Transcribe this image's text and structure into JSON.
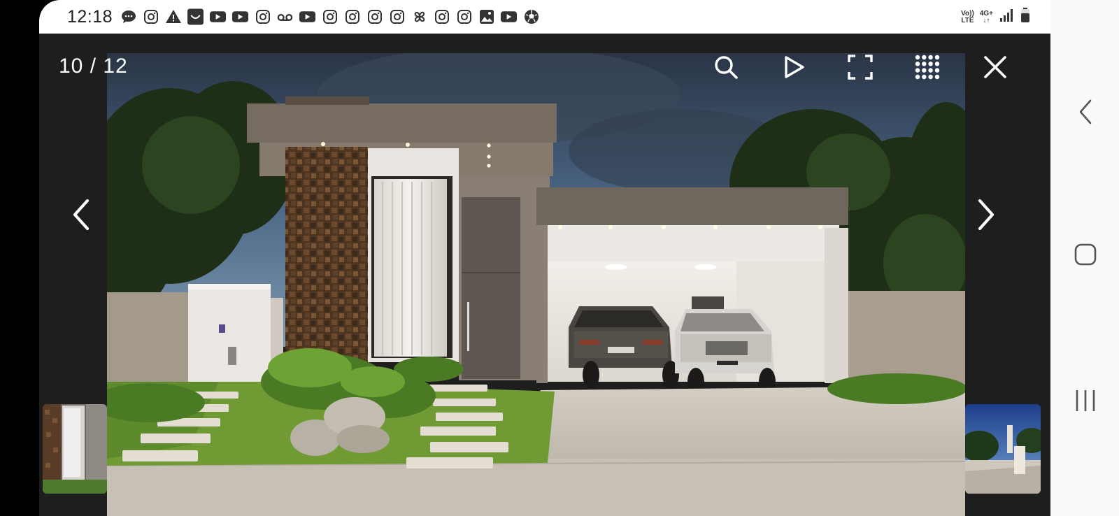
{
  "status_bar": {
    "time": "12:18",
    "notification_icons": [
      "chat-icon",
      "instagram-icon",
      "warning-icon",
      "smile-app-icon",
      "youtube-icon",
      "youtube-icon",
      "instagram-icon",
      "voicemail-icon",
      "youtube-icon",
      "instagram-icon",
      "instagram-icon",
      "instagram-icon",
      "instagram-icon",
      "pinwheel-icon",
      "instagram-icon",
      "instagram-icon",
      "gallery-icon",
      "youtube-icon",
      "soccer-ball-icon"
    ],
    "volte_top": "Vo))",
    "volte_bottom": "LTE",
    "network_top": "4G+",
    "network_bottom": "↓↑"
  },
  "viewer": {
    "counter": "10 / 12",
    "current": 10,
    "total": 12,
    "toolbar": [
      "search-icon",
      "play-icon",
      "fullscreen-icon",
      "grid-icon",
      "close-icon"
    ]
  },
  "system_nav": [
    "back-icon",
    "home-icon",
    "recents-icon"
  ],
  "colors": {
    "background": "#1e1e1e",
    "status_bar": "#ffffff",
    "nav_bar": "#fafafa",
    "icon": "#ffffff"
  }
}
